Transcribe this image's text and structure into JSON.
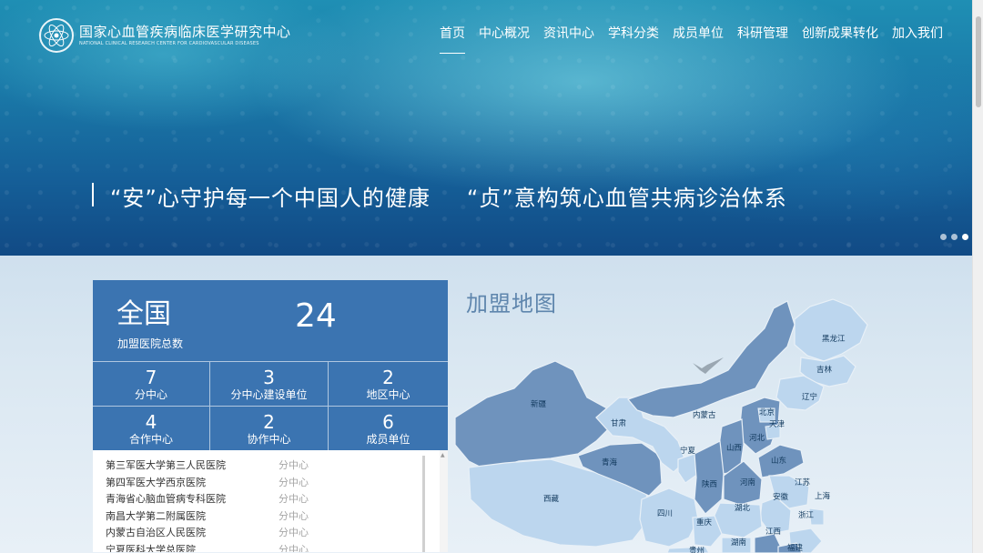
{
  "header": {
    "logo_cn": "国家心血管疾病临床医学研究中心",
    "logo_en": "NATIONAL CLINICAL RESEARCH CENTER FOR CARDIOVASCULAR DISEASES",
    "nav": [
      "首页",
      "中心概况",
      "资讯中心",
      "学科分类",
      "成员单位",
      "科研管理",
      "创新成果转化",
      "加入我们"
    ],
    "active_nav": "首页"
  },
  "hero": {
    "slogan_1": "“安”心守护每一个中国人的健康",
    "slogan_2": "“贞”意构筑心血管共病诊治体系",
    "slide_count": 3,
    "active_slide": 3
  },
  "stats": {
    "scope": "全国",
    "total_label": "加盟医院总数",
    "total_value": "24",
    "cells": [
      {
        "value": "7",
        "label": "分中心"
      },
      {
        "value": "3",
        "label": "分中心建设单位"
      },
      {
        "value": "2",
        "label": "地区中心"
      },
      {
        "value": "4",
        "label": "合作中心"
      },
      {
        "value": "2",
        "label": "协作中心"
      },
      {
        "value": "6",
        "label": "成员单位"
      }
    ]
  },
  "hospital_list": [
    {
      "name": "第三军医大学第三人民医院",
      "type": "分中心"
    },
    {
      "name": "第四军医大学西京医院",
      "type": "分中心"
    },
    {
      "name": "青海省心脑血管病专科医院",
      "type": "分中心"
    },
    {
      "name": "南昌大学第二附属医院",
      "type": "分中心"
    },
    {
      "name": "内蒙古自治区人民医院",
      "type": "分中心"
    },
    {
      "name": "宁夏医科大学总医院",
      "type": "分中心"
    }
  ],
  "map": {
    "title": "加盟地图",
    "provinces": [
      "黑龙江",
      "吉林",
      "辽宁",
      "内蒙古",
      "北京",
      "天津",
      "河北",
      "山西",
      "山东",
      "新疆",
      "甘肃",
      "宁夏",
      "青海",
      "陕西",
      "河南",
      "江苏",
      "上海",
      "安徽",
      "湖北",
      "浙江",
      "西藏",
      "四川",
      "重庆",
      "江西",
      "湖南",
      "福建",
      "贵州"
    ]
  },
  "colors": {
    "panel_blue": "#3b74b1",
    "map_dark": "#6f93bd",
    "map_light": "#bcd6ee",
    "map_title": "#5f86ad"
  }
}
